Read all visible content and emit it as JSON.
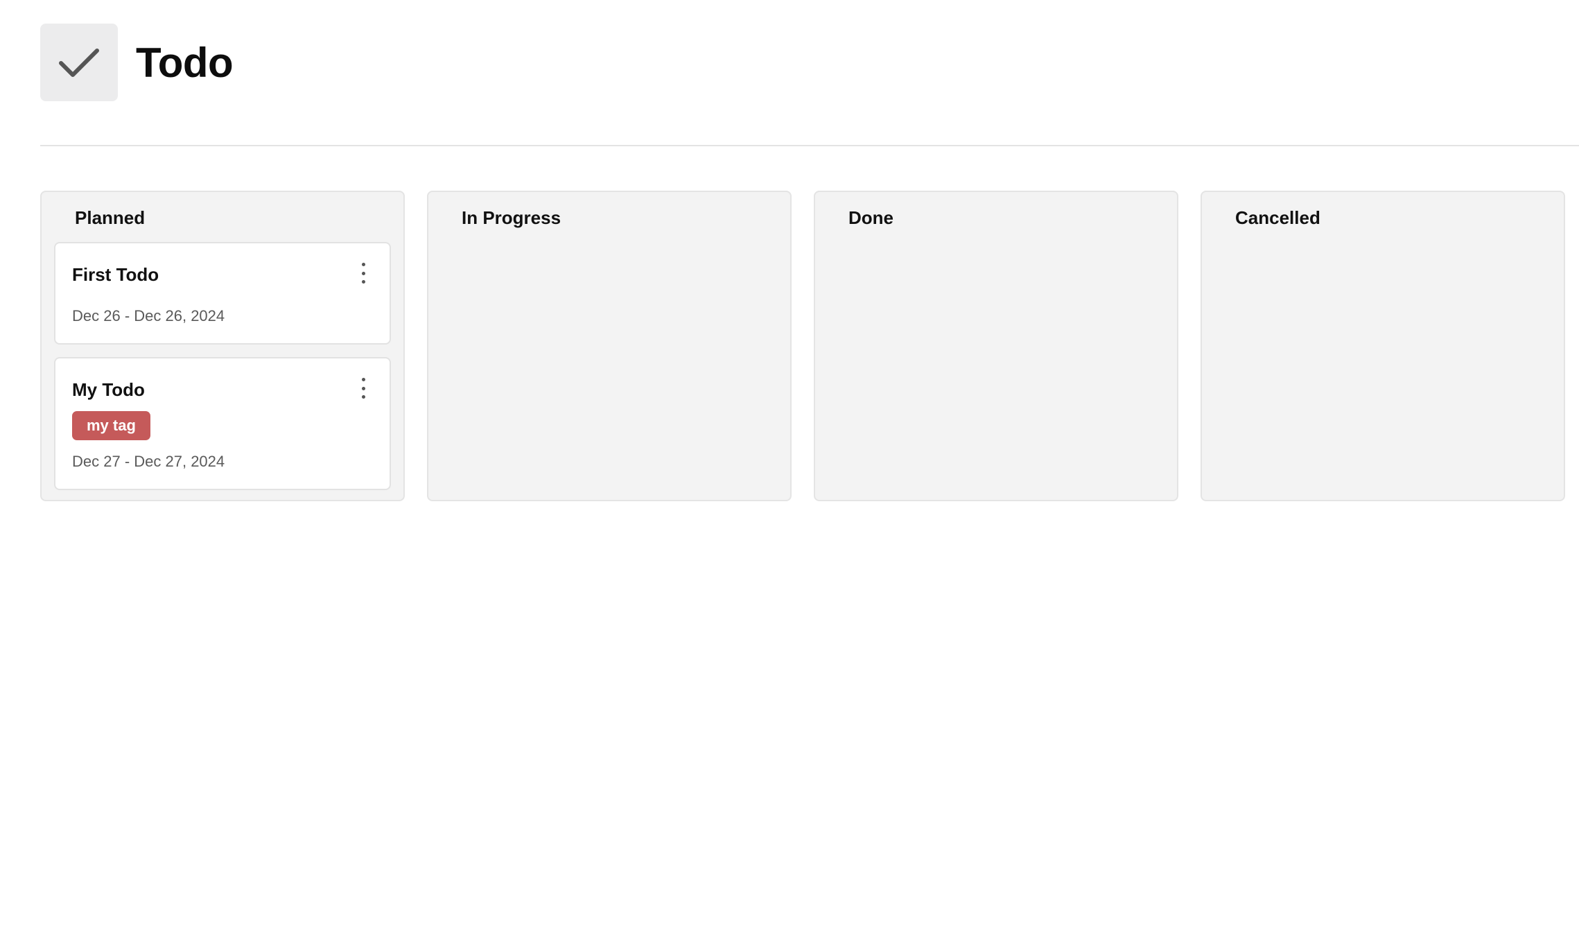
{
  "app": {
    "title": "Todo",
    "icon": "check-icon"
  },
  "board": {
    "columns": [
      {
        "title": "Planned",
        "cards": [
          {
            "title": "First Todo",
            "dates": "Dec 26 - Dec 26, 2024",
            "tags": []
          },
          {
            "title": "My Todo",
            "dates": "Dec 27 - Dec 27, 2024",
            "tags": [
              {
                "label": "my tag",
                "color": "#c55a5a"
              }
            ]
          }
        ]
      },
      {
        "title": "In Progress",
        "cards": []
      },
      {
        "title": "Done",
        "cards": []
      },
      {
        "title": "Cancelled",
        "cards": []
      }
    ]
  }
}
